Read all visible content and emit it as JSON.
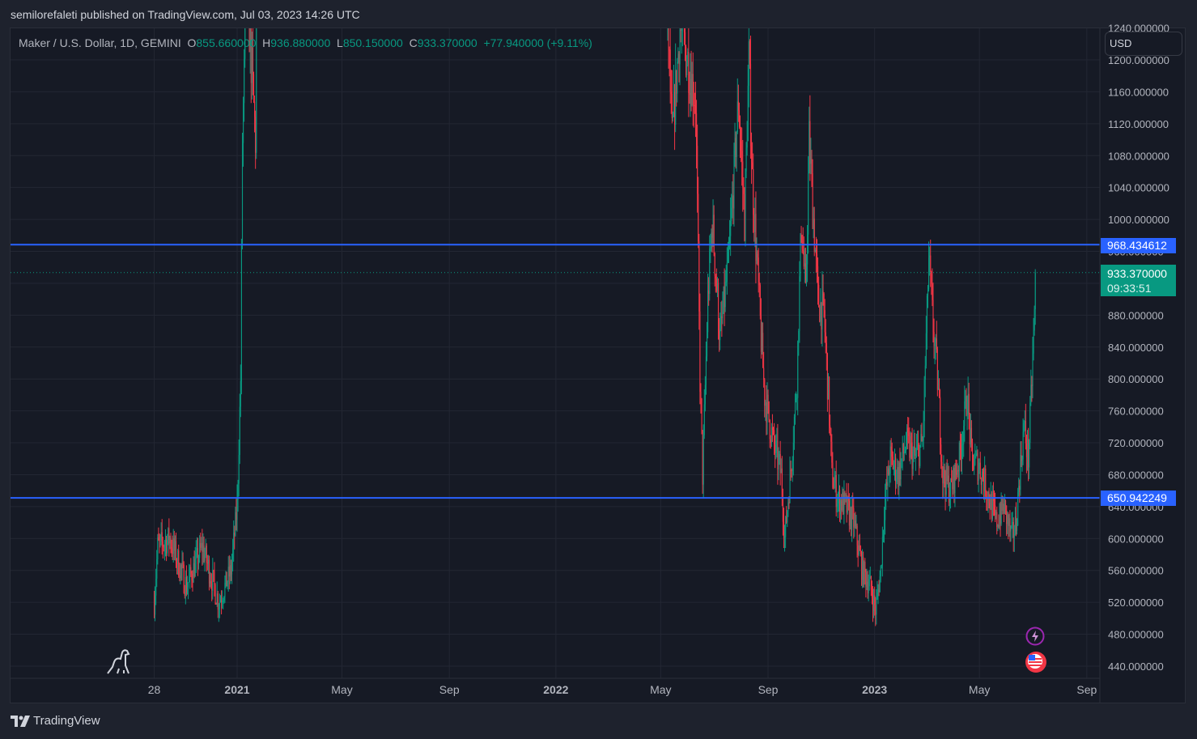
{
  "header": {
    "published": "semilorefaleti published on TradingView.com, Jul 03, 2023 14:26 UTC"
  },
  "legend": {
    "symbol": "Maker / U.S. Dollar, 1D, GEMINI",
    "o_label": "O",
    "open": "855.660000",
    "h_label": "H",
    "high": "936.880000",
    "l_label": "L",
    "low": "850.150000",
    "c_label": "C",
    "close": "933.370000",
    "change": "+77.940000 (+9.11%)"
  },
  "currency": "USD",
  "price_axis": [
    "1240.000000",
    "1200.000000",
    "1160.000000",
    "1120.000000",
    "1080.000000",
    "1040.000000",
    "1000.000000",
    "960.000000",
    "920.000000",
    "880.000000",
    "840.000000",
    "800.000000",
    "760.000000",
    "720.000000",
    "680.000000",
    "640.000000",
    "600.000000",
    "560.000000",
    "520.000000",
    "480.000000",
    "440.000000"
  ],
  "time_axis": [
    {
      "label": "28",
      "day": -95,
      "bold": false
    },
    {
      "label": "2021",
      "day": 0,
      "bold": true
    },
    {
      "label": "May",
      "day": 120,
      "bold": false
    },
    {
      "label": "Sep",
      "day": 243,
      "bold": false
    },
    {
      "label": "2022",
      "day": 365,
      "bold": true
    },
    {
      "label": "May",
      "day": 485,
      "bold": false
    },
    {
      "label": "Sep",
      "day": 608,
      "bold": false
    },
    {
      "label": "2023",
      "day": 730,
      "bold": true
    },
    {
      "label": "May",
      "day": 850,
      "bold": false
    },
    {
      "label": "Sep",
      "day": 973,
      "bold": false
    }
  ],
  "lines": [
    {
      "price": 968.434612,
      "label": "968.434612",
      "color": "#2962ff"
    },
    {
      "price": 650.942249,
      "label": "650.942249",
      "color": "#2962ff"
    }
  ],
  "last_price": {
    "price": 933.37,
    "label": "933.370000",
    "countdown": "09:33:51",
    "color": "#089981"
  },
  "colors": {
    "up": "#089981",
    "down": "#f23645"
  },
  "chart_data": {
    "type": "candlestick",
    "title": "Maker / U.S. Dollar, 1D, GEMINI",
    "x_unit": "days since 2021-01-01",
    "ylim": [
      420,
      1250
    ],
    "segments": [
      [
        [
          -95,
          520
        ],
        [
          -91,
          590
        ],
        [
          -77,
          600
        ],
        [
          -58,
          540
        ],
        [
          -40,
          590
        ],
        [
          -21,
          520
        ],
        [
          -7,
          560
        ],
        [
          0,
          640
        ],
        [
          4,
          800
        ],
        [
          6,
          1100
        ],
        [
          11,
          1300
        ],
        [
          21,
          1100
        ],
        [
          23,
          1250
        ]
      ],
      [
        [
          493,
          1250
        ],
        [
          498,
          1100
        ],
        [
          507,
          1240
        ],
        [
          516,
          1200
        ],
        [
          525,
          1150
        ],
        [
          530,
          800
        ],
        [
          533,
          680
        ],
        [
          539,
          900
        ],
        [
          544,
          1000
        ],
        [
          553,
          850
        ],
        [
          563,
          950
        ],
        [
          574,
          1150
        ],
        [
          581,
          1000
        ],
        [
          586,
          1200
        ],
        [
          590,
          1050
        ],
        [
          595,
          950
        ],
        [
          600,
          850
        ],
        [
          604,
          780
        ],
        [
          614,
          720
        ],
        [
          623,
          680
        ],
        [
          627,
          600
        ],
        [
          635,
          700
        ],
        [
          641,
          800
        ],
        [
          646,
          1000
        ],
        [
          651,
          900
        ],
        [
          655,
          1100
        ],
        [
          660,
          1000
        ],
        [
          665,
          900
        ],
        [
          672,
          880
        ],
        [
          677,
          780
        ],
        [
          681,
          680
        ],
        [
          688,
          650
        ],
        [
          697,
          640
        ],
        [
          706,
          620
        ],
        [
          716,
          560
        ],
        [
          725,
          540
        ],
        [
          731,
          510
        ],
        [
          737,
          560
        ],
        [
          741,
          640
        ],
        [
          748,
          700
        ],
        [
          757,
          680
        ],
        [
          766,
          720
        ],
        [
          776,
          700
        ],
        [
          785,
          720
        ],
        [
          792,
          950
        ],
        [
          796,
          880
        ],
        [
          802,
          800
        ],
        [
          808,
          680
        ],
        [
          817,
          660
        ],
        [
          827,
          700
        ],
        [
          836,
          780
        ],
        [
          841,
          700
        ],
        [
          850,
          690
        ],
        [
          859,
          660
        ],
        [
          869,
          620
        ],
        [
          878,
          640
        ],
        [
          887,
          600
        ],
        [
          892,
          620
        ],
        [
          896,
          680
        ],
        [
          901,
          740
        ],
        [
          906,
          700
        ],
        [
          910,
          800
        ],
        [
          915,
          933.37
        ]
      ]
    ]
  },
  "branding": {
    "logo_text": "TradingView"
  }
}
